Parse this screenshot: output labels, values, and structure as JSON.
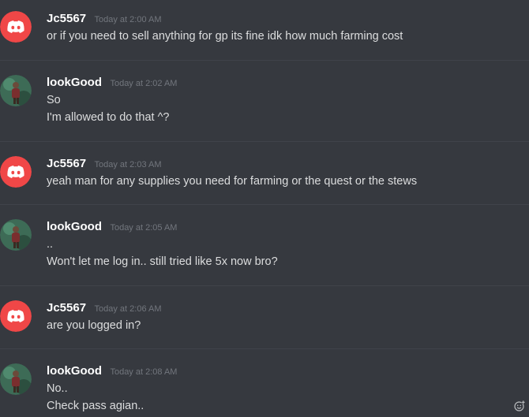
{
  "colors": {
    "background": "#36393f",
    "discord_red": "#f04747",
    "username": "#ffffff",
    "timestamp": "#72767d",
    "message_text": "#dcddde"
  },
  "messages": [
    {
      "author": "Jc5567",
      "avatar": "discord-logo-icon",
      "timestamp": "Today at 2:00 AM",
      "lines": [
        "or if you need to sell anything for gp its fine idk how much farming cost"
      ]
    },
    {
      "author": "lookGood",
      "avatar": "user-photo-avatar",
      "timestamp": "Today at 2:02 AM",
      "lines": [
        "So",
        "I'm allowed to do that ^?"
      ]
    },
    {
      "author": "Jc5567",
      "avatar": "discord-logo-icon",
      "timestamp": "Today at 2:03 AM",
      "lines": [
        "yeah man for any supplies you need for farming or the quest or the stews"
      ]
    },
    {
      "author": "lookGood",
      "avatar": "user-photo-avatar",
      "timestamp": "Today at 2:05 AM",
      "lines": [
        "..",
        "Won't let me log in.. still tried like 5x now bro?"
      ]
    },
    {
      "author": "Jc5567",
      "avatar": "discord-logo-icon",
      "timestamp": "Today at 2:06 AM",
      "lines": [
        "are you logged in?"
      ]
    },
    {
      "author": "lookGood",
      "avatar": "user-photo-avatar",
      "timestamp": "Today at 2:08 AM",
      "lines": [
        "No..",
        "Check pass agian.."
      ]
    }
  ],
  "emoji_button_icon": "add-reaction-icon"
}
